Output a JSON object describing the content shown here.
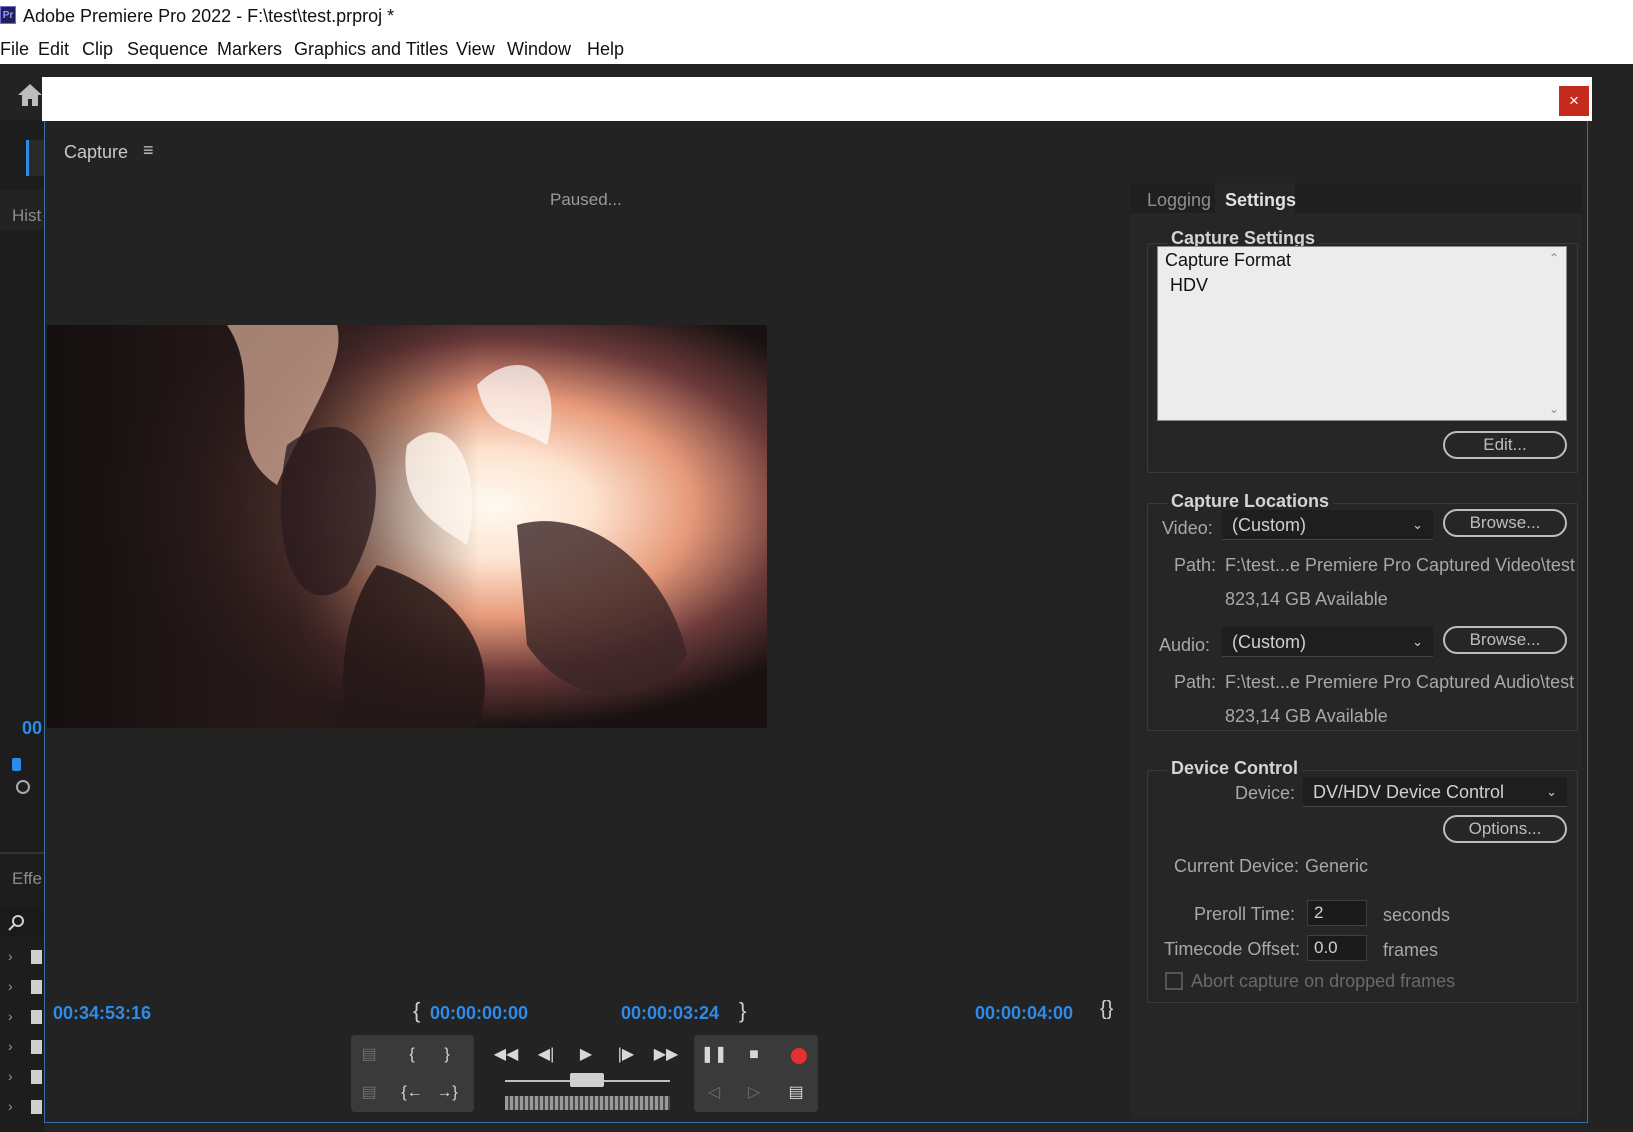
{
  "window": {
    "app_icon": "Pr",
    "title": "Adobe Premiere Pro 2022 - F:\\test\\test.prproj *"
  },
  "menu": [
    "File",
    "Edit",
    "Clip",
    "Sequence",
    "Markers",
    "Graphics and Titles",
    "View",
    "Window",
    "Help"
  ],
  "background": {
    "hist_label": "Hist",
    "effe_label": "Effe",
    "timecode_fragment": "00"
  },
  "dialog": {
    "close_label": "×",
    "panel_title": "Capture",
    "menu_icon": "≡",
    "status": "Paused..."
  },
  "timecodes": {
    "current": "00:34:53:16",
    "in_point": "00:00:00:00",
    "out_point": "00:00:03:24",
    "duration": "00:00:04:00"
  },
  "tabs": {
    "logging": "Logging",
    "settings": "Settings",
    "active": "Settings"
  },
  "capture_settings": {
    "heading": "Capture Settings",
    "format_label": "Capture Format",
    "format_value": "HDV",
    "edit_button": "Edit..."
  },
  "capture_locations": {
    "heading": "Capture Locations",
    "video_label": "Video:",
    "video_value": "(Custom)",
    "video_browse": "Browse...",
    "video_path_label": "Path:",
    "video_path": "F:\\test...e Premiere Pro Captured Video\\test",
    "video_available": "823,14 GB Available",
    "audio_label": "Audio:",
    "audio_value": "(Custom)",
    "audio_browse": "Browse...",
    "audio_path_label": "Path:",
    "audio_path": "F:\\test...e Premiere Pro Captured Audio\\test",
    "audio_available": "823,14 GB Available"
  },
  "device_control": {
    "heading": "Device Control",
    "device_label": "Device:",
    "device_value": "DV/HDV Device Control",
    "options_button": "Options...",
    "current_device_label": "Current Device:",
    "current_device_value": "Generic",
    "preroll_label": "Preroll Time:",
    "preroll_value": "2",
    "preroll_unit": "seconds",
    "offset_label": "Timecode Offset:",
    "offset_value": "0.0",
    "offset_unit": "frames",
    "abort_label": "Abort capture on dropped frames",
    "abort_checked": false
  },
  "colors": {
    "accent_blue": "#2d8ceb",
    "record_red": "#e3322f",
    "close_red": "#c42b1c"
  }
}
